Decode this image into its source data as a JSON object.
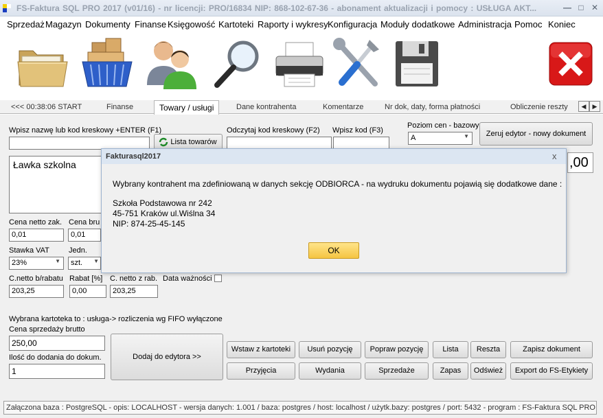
{
  "window": {
    "title": "FS-Faktura SQL PRO 2017 (v01/16)   -   nr licencji: PRO/16834    NIP: 868-102-67-36   -   abonament aktualizacji i pomocy : USŁUGA AKT...",
    "minimize": "—",
    "maximize": "□",
    "close": "✕"
  },
  "menu": [
    "Sprzedaż",
    "Magazyn",
    "Dokumenty",
    "Finanse",
    "Księgowość",
    "Kartoteki",
    "Raporty i wykresy",
    "Konfiguracja",
    "Moduły dodatkowe",
    "Administracja",
    "Pomoc",
    "Koniec"
  ],
  "toolbar": {
    "icons": [
      "folder-icon",
      "shopping-basket-icon",
      "users-icon",
      "magnifier-icon",
      "printer-icon",
      "tools-icon",
      "floppy-disk-icon",
      "close-icon"
    ]
  },
  "tabs": {
    "items": [
      "<<<  00:38:06  START",
      "Finanse",
      "Towary  / usługi",
      "Dane kontrahenta",
      "Komentarze",
      "Nr dok, daty, forma płatności",
      "Obliczenie reszty"
    ],
    "arrow_left": "◀",
    "arrow_right": "▶"
  },
  "form": {
    "search_label": "Wpisz nazwę lub kod kreskowy +ENTER (F1)",
    "search_value": "",
    "list_button": "Lista towarów",
    "barcode_label": "Odczytaj kod kreskowy (F2)",
    "barcode_value": "",
    "code_label": "Wpisz kod (F3)",
    "code_value": "",
    "price_level_label": "Poziom cen - bazowy",
    "price_level_value": "A",
    "reset_button": "Zeruj edytor -  nowy dokument",
    "product_name": "Ławka szkolna",
    "total_fragment": ",00",
    "net_price_buy_label": "Cena netto zak.",
    "net_price_buy_value": "0,01",
    "gross_price_label": "Cena bru",
    "gross_price_value": "0,01",
    "vat_label": "Stawka VAT",
    "vat_value": "23%",
    "unit_label": "Jedn.",
    "unit_value": "szt.",
    "net_before_discount_label": "C.netto b/rabatu",
    "net_before_discount_value": "203,25",
    "discount_label": "Rabat [%]",
    "discount_value": "0,00",
    "net_after_discount_label": "C. netto z rab.",
    "net_after_discount_value": "203,25",
    "expiry_label": "Data ważności",
    "fifo_info": "Wybrana kartoteka to : usługa-> rozliczenia wg FIFO wyłączone",
    "sale_price_label": "Cena sprzedaży brutto",
    "sale_price_value": "250,00",
    "qty_label": "Ilość do dodania do dokum.",
    "qty_value": "1",
    "add_button": "Dodaj do edytora      >>",
    "buttons": {
      "insert": "Wstaw z kartoteki",
      "delete": "Usuń pozycję",
      "edit": "Popraw pozycję",
      "list": "Lista",
      "change": "Reszta",
      "save": "Zapisz dokument",
      "receipts": "Przyjęcia",
      "issues": "Wydania",
      "sales": "Sprzedaże",
      "stock": "Zapas",
      "refresh": "Odśwież",
      "export": "Export do FS-Etykiety"
    }
  },
  "dialog": {
    "title": "Fakturasql2017",
    "close": "x",
    "message": "Wybrany kontrahent ma zdefiniowaną w danych sekcję ODBIORCA - na wydruku dokumentu pojawią się dodatkowe dane :",
    "line1": "Szkoła Podstawowa nr 242",
    "line2": "45-751 Kraków ul.Wiślna 34",
    "line3": "NIP: 874-25-45-145",
    "ok": "OK"
  },
  "status": "Załączona baza : PostgreSQL - opis: LOCALHOST - wersja danych: 1.001  / baza: postgres / host: localhost / użytk.bazy: postgres / port: 5432  - program :  FS-Faktura SQL PRO"
}
